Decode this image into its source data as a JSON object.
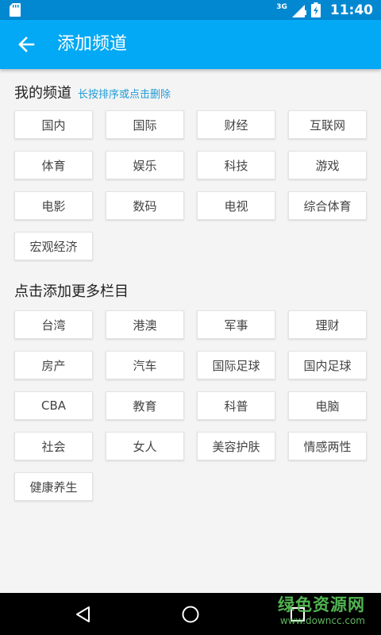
{
  "status_bar": {
    "network": "3G",
    "time": "11:40",
    "icons": [
      "sd-card-icon",
      "signal-icon",
      "battery-icon"
    ]
  },
  "app_bar": {
    "title": "添加频道",
    "back_icon": "arrow-back-icon"
  },
  "my_channels": {
    "title": "我的频道",
    "hint": "长按排序或点击删除",
    "items": [
      "国内",
      "国际",
      "财经",
      "互联网",
      "体育",
      "娱乐",
      "科技",
      "游戏",
      "电影",
      "数码",
      "电视",
      "综合体育",
      "宏观经济"
    ]
  },
  "more_channels": {
    "title": "点击添加更多栏目",
    "items": [
      "台湾",
      "港澳",
      "军事",
      "理财",
      "房产",
      "汽车",
      "国际足球",
      "国内足球",
      "CBA",
      "教育",
      "科普",
      "电脑",
      "社会",
      "女人",
      "美容护肤",
      "情感两性",
      "健康养生"
    ]
  },
  "nav_bar": {
    "buttons": [
      "back-triangle-icon",
      "home-circle-icon",
      "recents-square-icon"
    ],
    "watermark_text": "绿色资源网",
    "watermark_url": "www.downcc.com"
  },
  "colors": {
    "status_bar": "#0288d1",
    "app_bar": "#03a9f4",
    "hint": "#1e9bd7",
    "background": "#f4f4f4"
  }
}
